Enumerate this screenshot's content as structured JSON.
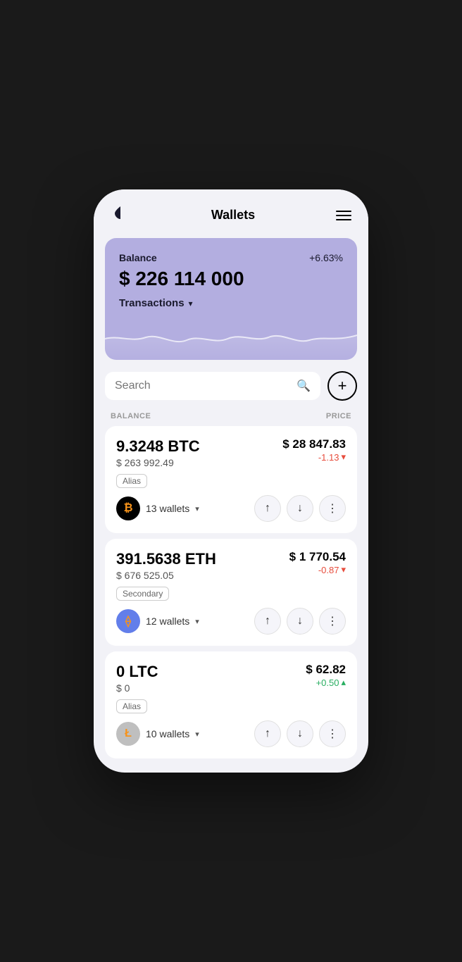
{
  "header": {
    "title": "Wallets",
    "menu_label": "menu"
  },
  "balance_card": {
    "label": "Balance",
    "percent": "+6.63%",
    "amount": "$ 226 114 000",
    "transactions_label": "Transactions"
  },
  "search": {
    "placeholder": "Search"
  },
  "list_headers": {
    "balance": "BALANCE",
    "price": "PRICE"
  },
  "coins": [
    {
      "amount": "9.3248 BTC",
      "usd_value": "$ 263 992.49",
      "alias": "Alias",
      "wallets": "13 wallets",
      "price": "$ 28 847.83",
      "change": "-1.13",
      "change_type": "negative",
      "coin_symbol": "₿"
    },
    {
      "amount": "391.5638 ETH",
      "usd_value": "$ 676 525.05",
      "alias": "Secondary",
      "wallets": "12 wallets",
      "price": "$ 1 770.54",
      "change": "-0.87",
      "change_type": "negative",
      "coin_symbol": "⟠"
    },
    {
      "amount": "0 LTC",
      "usd_value": "$ 0",
      "alias": "Alias",
      "wallets": "10 wallets",
      "price": "$ 62.82",
      "change": "+0.50",
      "change_type": "positive",
      "coin_symbol": "Ł"
    }
  ]
}
